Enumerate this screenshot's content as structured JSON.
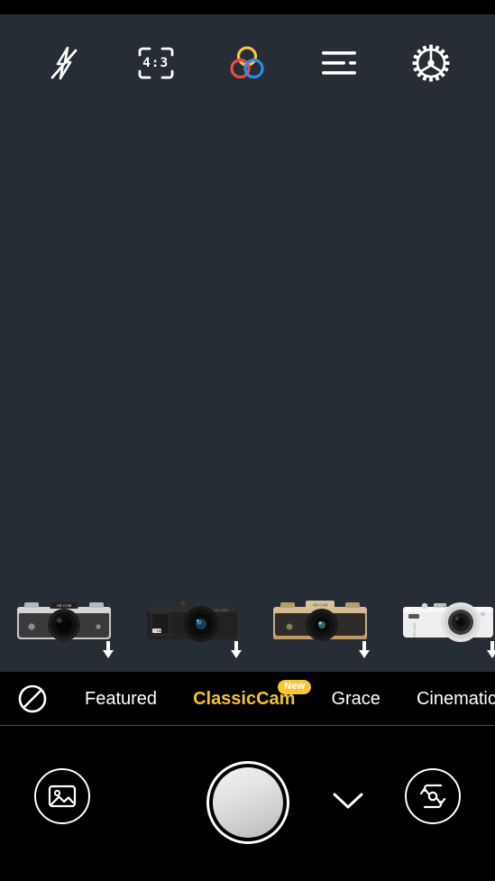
{
  "app": {
    "background_color": "#000000",
    "viewfinder_color": "#262d34",
    "accent_color": "#f5c032",
    "badge_color": "#f7c53a"
  },
  "top_toolbar": {
    "items": [
      {
        "name": "flash-off",
        "icon": "flash-off-icon",
        "label": "Flash off"
      },
      {
        "name": "aspect-ratio",
        "icon": "aspect-ratio-icon",
        "label": "4:3"
      },
      {
        "name": "color-filters",
        "icon": "color-rings-icon",
        "label": "Color filters"
      },
      {
        "name": "menu",
        "icon": "list-menu-icon",
        "label": "Menu"
      },
      {
        "name": "settings",
        "icon": "gear-icon",
        "label": "Settings"
      }
    ],
    "aspect_ratio_value": "4:3",
    "ring_colors": {
      "top": "#f6c445",
      "left": "#ee4b3a",
      "right": "#2e8ded"
    }
  },
  "camera_strip": {
    "items": [
      {
        "name": "camera-preset-1",
        "style": "retro-silver",
        "brand_text": "HD CAM",
        "download_icon": "download-arrow-icon"
      },
      {
        "name": "camera-preset-2",
        "style": "compact-black",
        "brand_text": "HD",
        "download_icon": "download-arrow-icon"
      },
      {
        "name": "camera-preset-3",
        "style": "retro-gold",
        "brand_text": "HD CAM",
        "download_icon": "download-arrow-icon"
      },
      {
        "name": "camera-preset-4",
        "style": "mirrorless-white",
        "brand_text": "HD CAM",
        "download_icon": "download-arrow-icon"
      }
    ]
  },
  "filter_tabs": {
    "none_icon": "no-filter-icon",
    "tabs": [
      {
        "label": "Featured",
        "active": false,
        "badge": null
      },
      {
        "label": "ClassicCam",
        "active": true,
        "badge": "New"
      },
      {
        "label": "Grace",
        "active": false,
        "badge": null
      },
      {
        "label": "Cinematic",
        "active": false,
        "badge": "clipped"
      }
    ]
  },
  "bottom_bar": {
    "gallery_button": {
      "label": "Gallery",
      "icon": "gallery-image-icon"
    },
    "shutter_button": {
      "label": "Shutter"
    },
    "expand_button": {
      "label": "Expand",
      "icon": "chevron-down-icon"
    },
    "flip_button": {
      "label": "Switch camera",
      "icon": "camera-flip-icon"
    }
  }
}
